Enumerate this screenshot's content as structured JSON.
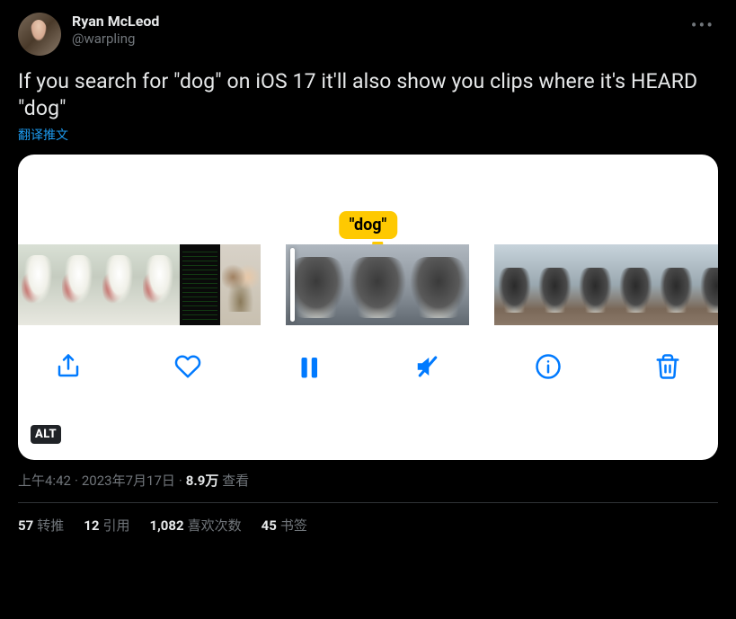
{
  "author": {
    "display_name": "Ryan McLeod",
    "handle": "@warpling"
  },
  "tweet_text": "If you search for \"dog\" on iOS 17 it'll also show you clips where it's HEARD \"dog\"",
  "translate_label": "翻译推文",
  "media": {
    "tooltip": "\"dog\"",
    "alt_badge": "ALT"
  },
  "meta": {
    "time": "上午4:42",
    "date": "2023年7月17日",
    "views_count": "8.9万",
    "views_label": "查看"
  },
  "stats": {
    "retweets_count": "57",
    "retweets_label": "转推",
    "quotes_count": "12",
    "quotes_label": "引用",
    "likes_count": "1,082",
    "likes_label": "喜欢次数",
    "bookmarks_count": "45",
    "bookmarks_label": "书签"
  }
}
